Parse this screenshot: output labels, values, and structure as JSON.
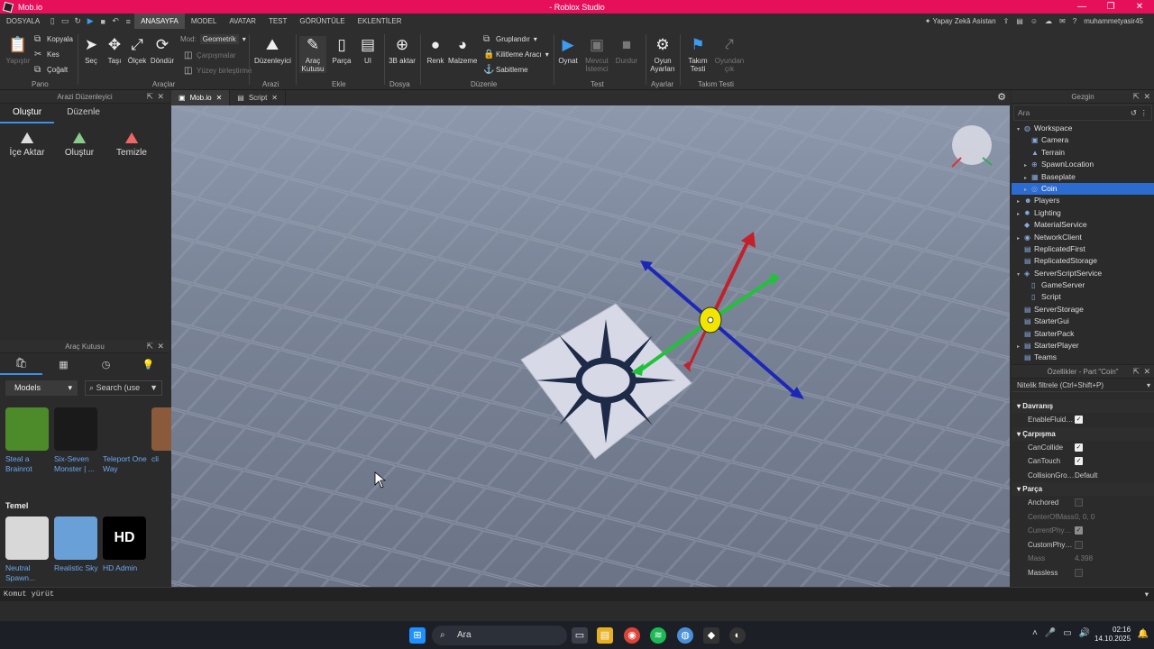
{
  "window": {
    "title": "Mob.io - Roblox Studio",
    "app_name": "Mob.io",
    "center_title": "- Roblox Studio"
  },
  "menu": {
    "file": "DOSYALA",
    "tabs": [
      "ANASAYFA",
      "MODEL",
      "AVATAR",
      "TEST",
      "GÖRÜNTÜLE",
      "EKLENTİLER"
    ],
    "active_tab": "ANASAYFA",
    "assistant": "Yapay Zekâ Asistan",
    "username": "muhammetyasir45"
  },
  "ribbon": {
    "pano": {
      "paste": "Yapıştır",
      "copy": "Kopyala",
      "cut": "Kes",
      "duplicate": "Çoğalt",
      "group": "Pano"
    },
    "araclar": {
      "select": "Seç",
      "move": "Taşı",
      "scale": "Ölçek",
      "rotate": "Döndür",
      "mode_label": "Mod:",
      "mode_value": "Geometrik",
      "collisions": "Çarpışmalar",
      "join": "Yüzey birleştirme",
      "group": "Araçlar"
    },
    "arazi": {
      "editor": "Düzenleyici",
      "group": "Arazi"
    },
    "ekle": {
      "toolbox": "Araç Kutusu",
      "part": "Parça",
      "ui": "UI",
      "group": "Ekle"
    },
    "dosya": {
      "import3d": "3B aktar",
      "group": "Dosya"
    },
    "duzenle": {
      "color": "Renk",
      "material": "Malzeme",
      "group_btn": "Gruplandır",
      "lock": "Kilitleme Aracı",
      "anchor": "Sabitleme",
      "group": "Düzenle"
    },
    "test": {
      "play": "Oynat",
      "current_client": "Mevcut İstemci",
      "stop": "Durdur",
      "group": "Test"
    },
    "ayarlar": {
      "game_settings": "Oyun Ayarları",
      "group": "Ayarlar"
    },
    "takim": {
      "team_test": "Takım Testi",
      "exit": "Oyundan çık",
      "group": "Takım Testi"
    }
  },
  "left_panel": {
    "title": "Arazi Düzenleyici",
    "tabs": [
      "Oluştur",
      "Düzenle"
    ],
    "buttons": [
      "İçe Aktar",
      "Oluştur",
      "Temizle"
    ]
  },
  "toolbox": {
    "title": "Araç Kutusu",
    "category": "Models",
    "search_placeholder": "Search (use",
    "items": [
      {
        "name": "Steal a Brainrot",
        "color": "#4c8a2a"
      },
      {
        "name": "Six-Seven Monster | ...",
        "color": "#1a1a1a"
      },
      {
        "name": "Teleport One Way",
        "color": "#2b2b2b"
      },
      {
        "name": "cli",
        "color": "#8a5a3a"
      }
    ],
    "section": "Temel",
    "basic": [
      {
        "name": "Neutral Spawn...",
        "color": "#d8d8d8"
      },
      {
        "name": "Realistic Sky",
        "color": "#6aa0d8"
      },
      {
        "name": "HD Admin",
        "color": "#000000",
        "label": "HD"
      }
    ]
  },
  "doc_tabs": [
    {
      "label": "Mob.io",
      "active": true
    },
    {
      "label": "Script",
      "active": false
    }
  ],
  "explorer": {
    "title": "Gezgin",
    "filter_placeholder": "Ara",
    "items": [
      {
        "label": "Workspace",
        "level": 0,
        "arrow": "▾",
        "icon": "◍"
      },
      {
        "label": "Camera",
        "level": 1,
        "arrow": "",
        "icon": "▣"
      },
      {
        "label": "Terrain",
        "level": 1,
        "arrow": "",
        "icon": "▲"
      },
      {
        "label": "SpawnLocation",
        "level": 1,
        "arrow": "▸",
        "icon": "⊕"
      },
      {
        "label": "Baseplate",
        "level": 1,
        "arrow": "▸",
        "icon": "▦"
      },
      {
        "label": "Coin",
        "level": 1,
        "arrow": "▸",
        "icon": "◎",
        "selected": true
      },
      {
        "label": "Players",
        "level": 0,
        "arrow": "▸",
        "icon": "☻"
      },
      {
        "label": "Lighting",
        "level": 0,
        "arrow": "▸",
        "icon": "✹"
      },
      {
        "label": "MaterialService",
        "level": 0,
        "arrow": "",
        "icon": "◆"
      },
      {
        "label": "NetworkClient",
        "level": 0,
        "arrow": "▸",
        "icon": "◉"
      },
      {
        "label": "ReplicatedFirst",
        "level": 0,
        "arrow": "",
        "icon": "▤"
      },
      {
        "label": "ReplicatedStorage",
        "level": 0,
        "arrow": "",
        "icon": "▤"
      },
      {
        "label": "ServerScriptService",
        "level": 0,
        "arrow": "▾",
        "icon": "◈"
      },
      {
        "label": "GameServer",
        "level": 1,
        "arrow": "",
        "icon": "▯"
      },
      {
        "label": "Script",
        "level": 1,
        "arrow": "",
        "icon": "▯"
      },
      {
        "label": "ServerStorage",
        "level": 0,
        "arrow": "",
        "icon": "▤"
      },
      {
        "label": "StarterGui",
        "level": 0,
        "arrow": "",
        "icon": "▤"
      },
      {
        "label": "StarterPack",
        "level": 0,
        "arrow": "",
        "icon": "▤"
      },
      {
        "label": "StarterPlayer",
        "level": 0,
        "arrow": "▸",
        "icon": "▤"
      },
      {
        "label": "Teams",
        "level": 0,
        "arrow": "",
        "icon": "▤"
      }
    ]
  },
  "properties": {
    "title": "Özellikler - Part \"Coin\"",
    "filter_placeholder": "Nitelik filtrele (Ctrl+Shift+P)",
    "rows": [
      {
        "type": "sec",
        "label": "Davranış"
      },
      {
        "type": "prop",
        "label": "EnableFluidF...",
        "value": "",
        "check": true
      },
      {
        "type": "sec",
        "label": "Çarpışma"
      },
      {
        "type": "prop",
        "label": "CanCollide",
        "value": "",
        "check": true
      },
      {
        "type": "prop",
        "label": "CanTouch",
        "value": "",
        "check": true
      },
      {
        "type": "prop",
        "label": "CollisionGroup",
        "value": "Default"
      },
      {
        "type": "sec",
        "label": "Parça"
      },
      {
        "type": "prop",
        "label": "Anchored",
        "value": "",
        "check": false
      },
      {
        "type": "prop",
        "label": "CenterOfMass",
        "value": "0, 0, 0",
        "dim": true
      },
      {
        "type": "prop",
        "label": "CurrentPhysi...",
        "value": "",
        "check": true,
        "dim": true
      },
      {
        "type": "prop",
        "label": "CustomPhysi...",
        "value": "",
        "check": false
      },
      {
        "type": "prop",
        "label": "Mass",
        "value": "4.398",
        "dim": true
      },
      {
        "type": "prop",
        "label": "Massless",
        "value": "",
        "check": false
      }
    ]
  },
  "command_bar": {
    "placeholder": "Komut yürüt"
  },
  "taskbar": {
    "search": "Ara",
    "time": "02:16",
    "date": "14.10.2025"
  }
}
